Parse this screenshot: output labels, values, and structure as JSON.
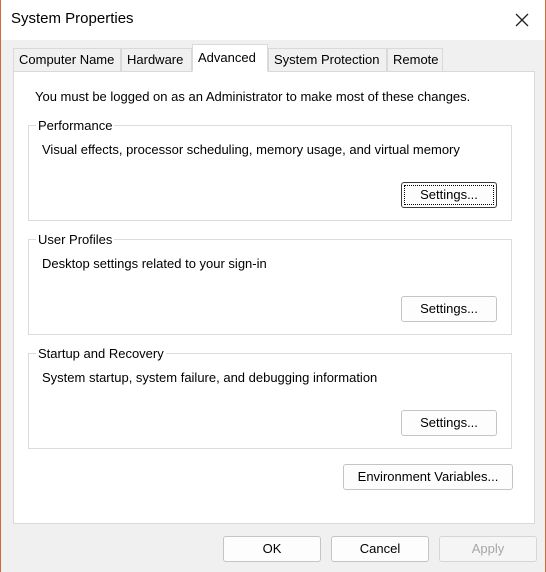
{
  "window": {
    "title": "System Properties"
  },
  "tabs": [
    {
      "label": "Computer Name"
    },
    {
      "label": "Hardware"
    },
    {
      "label": "Advanced",
      "active": true
    },
    {
      "label": "System Protection"
    },
    {
      "label": "Remote"
    }
  ],
  "admin_note": "You must be logged on as an Administrator to make most of these changes.",
  "groups": [
    {
      "title": "Performance",
      "description": "Visual effects, processor scheduling, memory usage, and virtual memory",
      "button": "Settings..."
    },
    {
      "title": "User Profiles",
      "description": "Desktop settings related to your sign-in",
      "button": "Settings..."
    },
    {
      "title": "Startup and Recovery",
      "description": "System startup, system failure, and debugging information",
      "button": "Settings..."
    }
  ],
  "env_button": "Environment Variables...",
  "footer": {
    "ok": "OK",
    "cancel": "Cancel",
    "apply": "Apply"
  },
  "colors": {
    "accent_border": "#d06a3a",
    "disabled_text": "#a6a6a6"
  },
  "icons": {
    "close": "close-icon"
  }
}
